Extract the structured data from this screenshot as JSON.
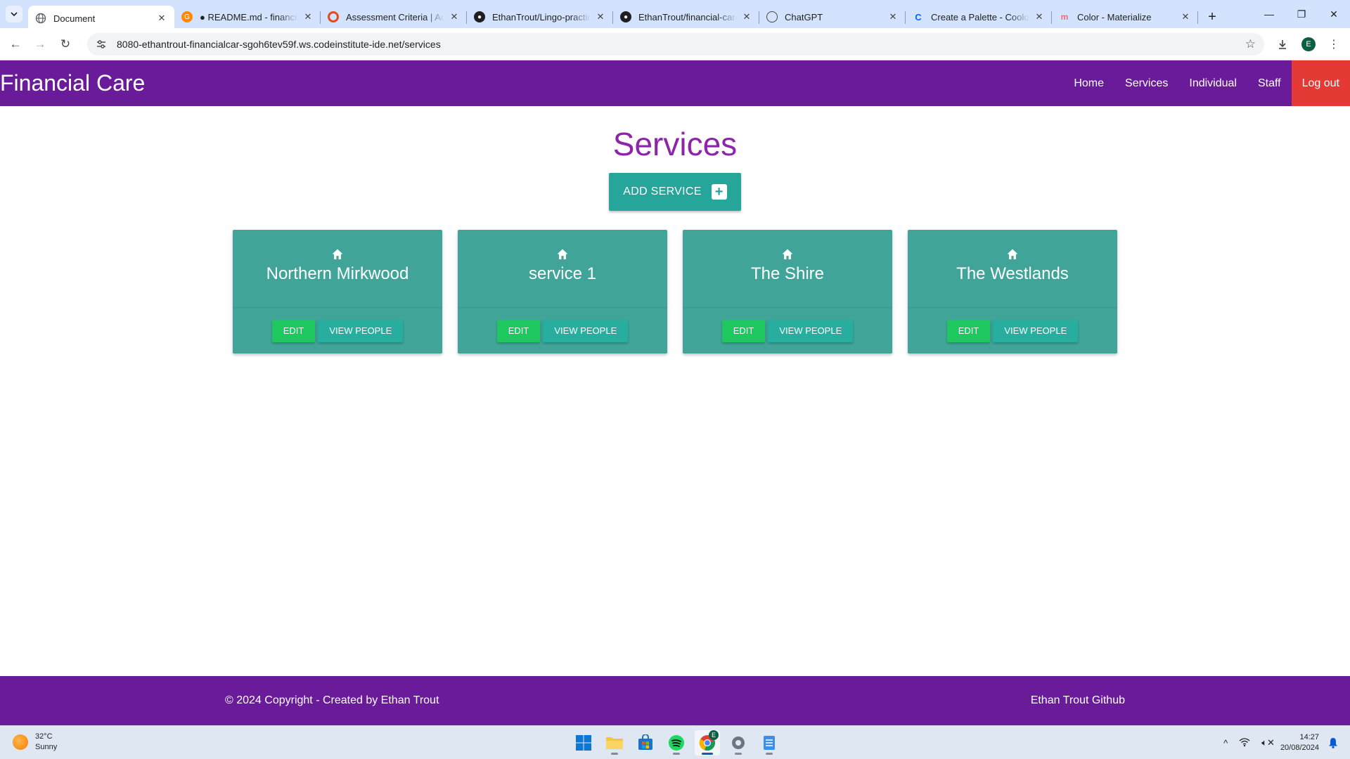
{
  "browser": {
    "tabs": [
      {
        "title": "Document",
        "active": true,
        "favicon": "globe-icon",
        "color": "#5f6368"
      },
      {
        "title": "● README.md - financial-",
        "active": false,
        "favicon": "gitpod-icon",
        "color": "#ff8a00"
      },
      {
        "title": "Assessment Criteria | Acti",
        "active": false,
        "favicon": "circle-logo-icon",
        "color": "#e8481c"
      },
      {
        "title": "EthanTrout/Lingo-practice",
        "active": false,
        "favicon": "github-icon",
        "color": "#1f1f1f"
      },
      {
        "title": "EthanTrout/financial-care:",
        "active": false,
        "favicon": "github-icon",
        "color": "#1f1f1f"
      },
      {
        "title": "ChatGPT",
        "active": false,
        "favicon": "chatgpt-icon",
        "color": "#444444"
      },
      {
        "title": "Create a Palette - Coolors",
        "active": false,
        "favicon": "coolors-icon",
        "color": "#0066ff"
      },
      {
        "title": "Color - Materialize",
        "active": false,
        "favicon": "materialize-icon",
        "color": "#ee6e73"
      }
    ],
    "url": "8080-ethantrout-financialcar-sgoh6tev59f.ws.codeinstitute-ide.net/services",
    "profile_initial": "E"
  },
  "site": {
    "brand": "Financial Care",
    "nav": {
      "home": "Home",
      "services": "Services",
      "individual": "Individual",
      "staff": "Staff",
      "logout": "Log out"
    },
    "colors": {
      "primary": "#6a1b9a",
      "title": "#8e24aa",
      "teal": "#26a69a",
      "card": "#40a499",
      "edit": "#1fc75f",
      "logout": "#e53935"
    }
  },
  "main": {
    "title": "Services",
    "add_button": "ADD SERVICE",
    "cards": [
      {
        "name": "Northern Mirkwood",
        "edit": "EDIT",
        "view": "VIEW PEOPLE"
      },
      {
        "name": "service 1",
        "edit": "EDIT",
        "view": "VIEW PEOPLE"
      },
      {
        "name": "The Shire",
        "edit": "EDIT",
        "view": "VIEW PEOPLE"
      },
      {
        "name": "The Westlands",
        "edit": "EDIT",
        "view": "VIEW PEOPLE"
      }
    ]
  },
  "footer": {
    "copyright": "© 2024 Copyright - Created by Ethan Trout",
    "github_link": "Ethan Trout Github"
  },
  "taskbar": {
    "temperature": "32°C",
    "weather": "Sunny",
    "time": "14:27",
    "date": "20/08/2024",
    "chrome_badge": "E"
  }
}
